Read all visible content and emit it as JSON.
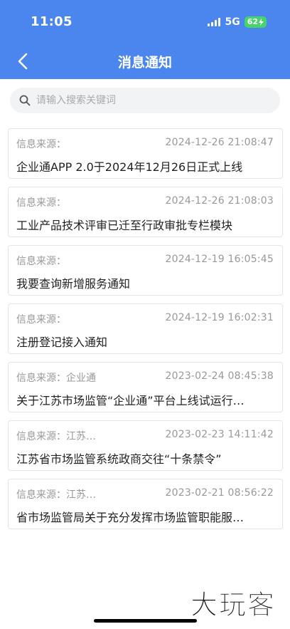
{
  "status_bar": {
    "time": "11:05",
    "network": "5G",
    "battery": "62"
  },
  "nav": {
    "title": "消息通知",
    "back_icon": "chevron-left-icon"
  },
  "search": {
    "placeholder": "请输入搜索关键词",
    "value": "",
    "icon": "search-icon"
  },
  "notifications": [
    {
      "source": "信息来源：",
      "time": "2024-12-26 21:08:47",
      "title": "企业通APP 2.0于2024年12月26日正式上线"
    },
    {
      "source": "信息来源：",
      "time": "2024-12-26 21:08:03",
      "title": "工业产品技术评审已迁至行政审批专栏模块"
    },
    {
      "source": "信息来源：",
      "time": "2024-12-19 16:05:45",
      "title": "我要查询新增服务通知"
    },
    {
      "source": "信息来源：",
      "time": "2024-12-19 16:02:31",
      "title": "注册登记接入通知"
    },
    {
      "source": "信息来源：企业通",
      "time": "2023-02-24 08:45:38",
      "title": "关于江苏市场监管“企业通”平台上线试运行…"
    },
    {
      "source": "信息来源：江苏…",
      "time": "2023-02-23 14:11:42",
      "title": "江苏省市场监管系统政商交往“十条禁令”"
    },
    {
      "source": "信息来源：江苏…",
      "time": "2023-02-21 08:56:22",
      "title": "省市场监管局关于充分发挥市场监管职能服…"
    }
  ],
  "colors": {
    "header": "#4a86ee",
    "battery": "#47d36a",
    "muted_text": "#999999",
    "title_text": "#222222"
  },
  "watermark": "大玩客"
}
